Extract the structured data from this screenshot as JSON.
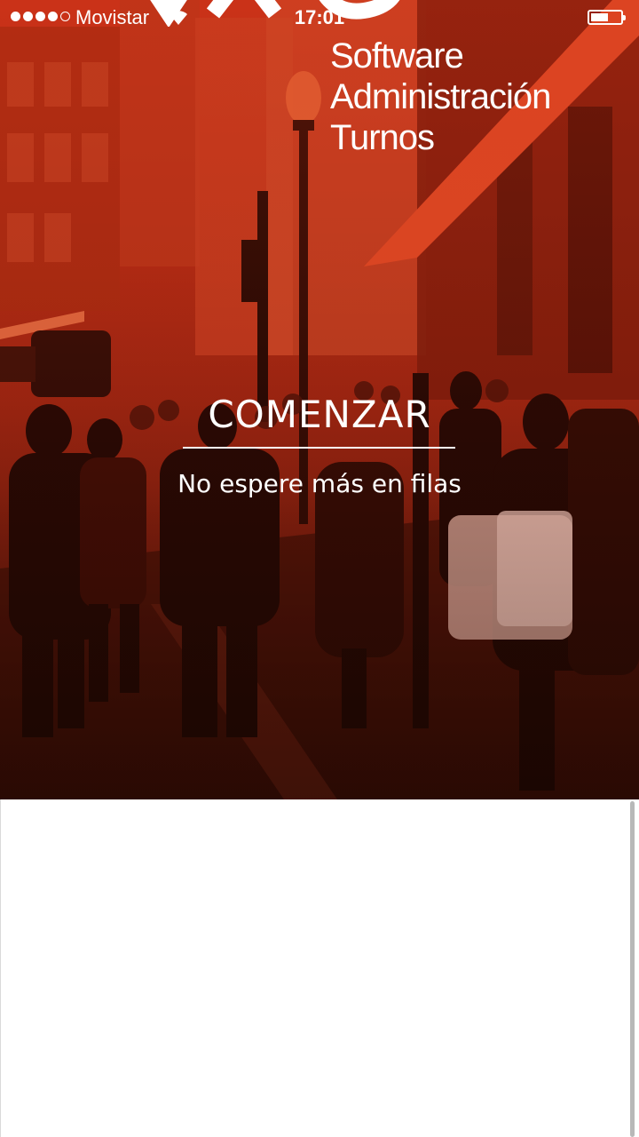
{
  "status_bar": {
    "signal_bars_filled": 4,
    "signal_bars_total": 5,
    "carrier": "Movistar",
    "time": "17:01",
    "battery_level": 0.6
  },
  "logo": {
    "lines": [
      "Software",
      "Administración",
      "Turnos"
    ]
  },
  "hero": {
    "title": "COMENZAR",
    "subtitle": "No espere más en filas",
    "accent_color": "#c8321a"
  },
  "icons": {
    "wifi": "wifi-icon",
    "battery": "battery-icon"
  }
}
